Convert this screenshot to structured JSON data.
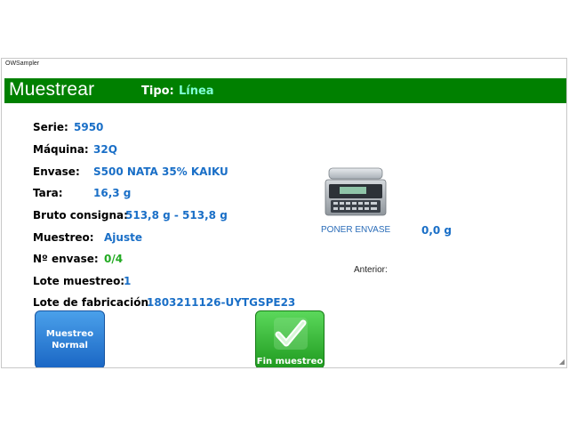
{
  "window": {
    "title": "OWSampler"
  },
  "header": {
    "title": "Muestrear",
    "tipo_label": "Tipo:",
    "tipo_value": "Línea",
    "bg_color": "#008000"
  },
  "fields": {
    "serie": {
      "label": "Serie:",
      "value": "5950"
    },
    "maquina": {
      "label": "Máquina:",
      "value": "32Q"
    },
    "envase": {
      "label": "Envase:",
      "value": "S500 NATA 35% KAIKU"
    },
    "tara": {
      "label": "Tara:",
      "value": "16,3 g"
    },
    "bruto": {
      "label": "Bruto consigna:",
      "value": "513,8 g - 513,8 g"
    },
    "muestreo": {
      "label": "Muestreo:",
      "value": "Ajuste"
    },
    "n_envase": {
      "label": "Nº envase:",
      "value": "0/4"
    },
    "lote_muestreo": {
      "label": "Lote muestreo:",
      "value": "1"
    },
    "lote_fabricacion": {
      "label": "Lote de fabricación:",
      "value": "1803211126-UYTGSPE23"
    }
  },
  "scale": {
    "icon": "weighing-scale-icon",
    "prompt": "PONER ENVASE",
    "weight": "0,0 g",
    "anterior_label": "Anterior:"
  },
  "buttons": {
    "muestreo_normal": {
      "line1": "Muestreo",
      "line2": "Normal"
    },
    "fin_muestreo": {
      "label": "Fin muestreo",
      "icon": "checkmark-icon"
    }
  },
  "colors": {
    "value_blue": "#1a6fc7",
    "value_green": "#22aa22",
    "tipo_value": "#7fffd4"
  }
}
